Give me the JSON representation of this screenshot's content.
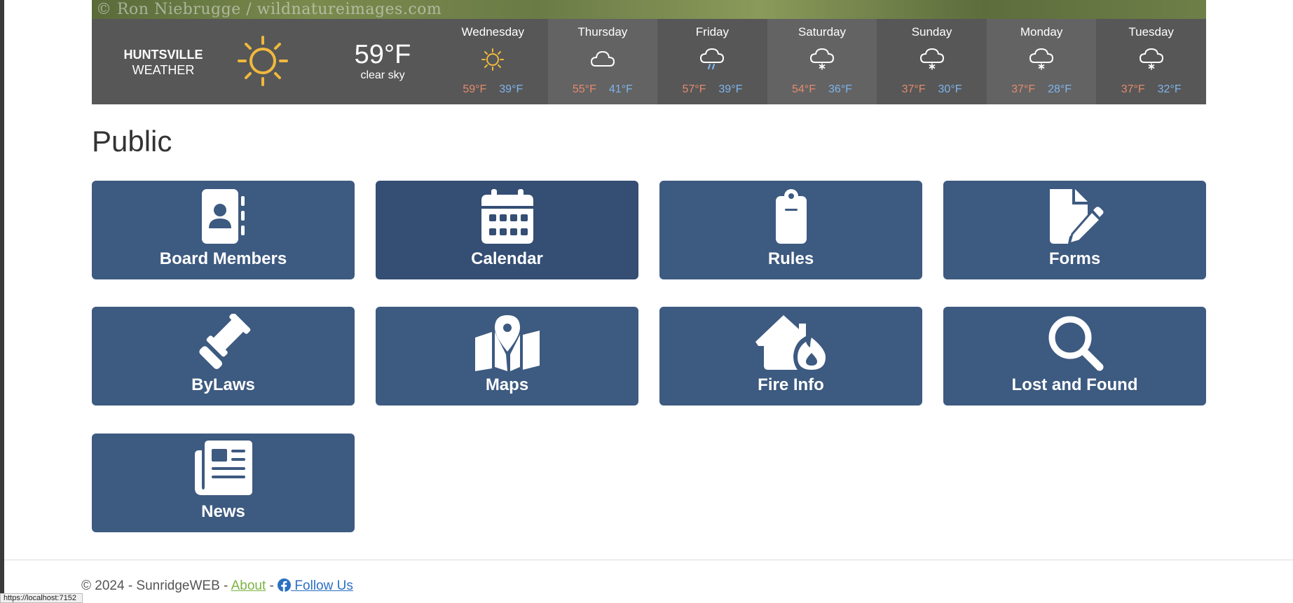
{
  "hero": {
    "credit": "© Ron Niebrugge / wildnatureimages.com"
  },
  "weather": {
    "city_line1": "HUNTSVILLE",
    "city_line2": "WEATHER",
    "current_icon": "sun-icon",
    "current_temp": "59°F",
    "current_desc": "clear sky",
    "days": [
      {
        "name": "Wednesday",
        "icon": "sun-icon",
        "hi": "59°F",
        "lo": "39°F"
      },
      {
        "name": "Thursday",
        "icon": "cloud-icon",
        "hi": "55°F",
        "lo": "41°F"
      },
      {
        "name": "Friday",
        "icon": "rain-cloud-icon",
        "hi": "57°F",
        "lo": "39°F"
      },
      {
        "name": "Saturday",
        "icon": "snow-cloud-icon",
        "hi": "54°F",
        "lo": "36°F"
      },
      {
        "name": "Sunday",
        "icon": "snow-cloud-icon",
        "hi": "37°F",
        "lo": "30°F"
      },
      {
        "name": "Monday",
        "icon": "snow-cloud-icon",
        "hi": "37°F",
        "lo": "28°F"
      },
      {
        "name": "Tuesday",
        "icon": "snow-cloud-icon",
        "hi": "37°F",
        "lo": "32°F"
      }
    ],
    "colors": {
      "sun": "#f0b93c",
      "hi": "#e58a6d",
      "lo": "#7fb4ec"
    }
  },
  "section": {
    "title": "Public"
  },
  "tiles": [
    {
      "label": "Board Members",
      "icon": "address-book-icon"
    },
    {
      "label": "Calendar",
      "icon": "calendar-icon"
    },
    {
      "label": "Rules",
      "icon": "clipboard-icon"
    },
    {
      "label": "Forms",
      "icon": "file-pen-icon"
    },
    {
      "label": "ByLaws",
      "icon": "gavel-icon"
    },
    {
      "label": "Maps",
      "icon": "map-location-icon"
    },
    {
      "label": "Fire Info",
      "icon": "house-fire-icon"
    },
    {
      "label": "Lost and Found",
      "icon": "magnifying-glass-icon"
    },
    {
      "label": "News",
      "icon": "newspaper-icon"
    }
  ],
  "footer": {
    "copyright": "© 2024 - SunridgeWEB - ",
    "about": "About",
    "sep": " - ",
    "follow": " Follow Us",
    "facebook_icon": "facebook-icon"
  },
  "status_bar": {
    "url": "https://localhost:7152"
  },
  "colors": {
    "tile": "#3d5a80",
    "tile_active": "#344e74",
    "weather_bg": "#575757"
  }
}
